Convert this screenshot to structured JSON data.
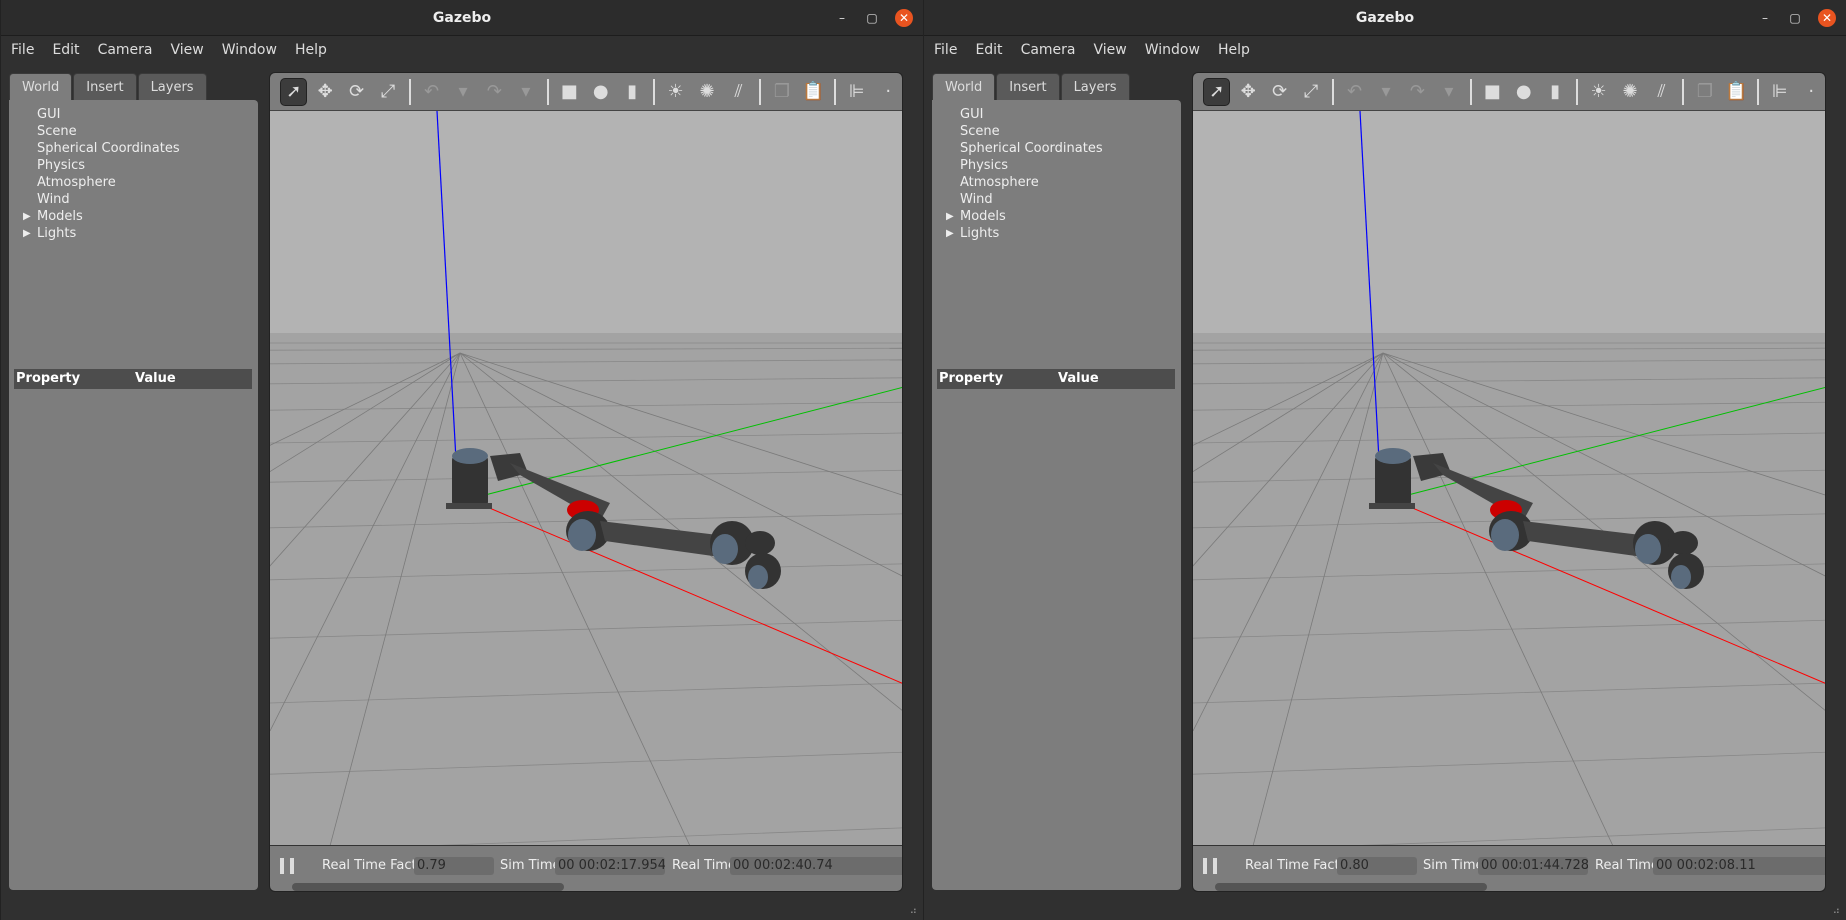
{
  "windows": [
    {
      "title": "Gazebo",
      "menu": [
        "File",
        "Edit",
        "Camera",
        "View",
        "Window",
        "Help"
      ],
      "tabs": [
        "World",
        "Insert",
        "Layers"
      ],
      "tree": [
        "GUI",
        "Scene",
        "Spherical Coordinates",
        "Physics",
        "Atmosphere",
        "Wind",
        "Models",
        "Lights"
      ],
      "property_header": "Property",
      "value_header": "Value",
      "status": {
        "rtf_label": "Real Time Factor:",
        "rtf": "0.79",
        "sim_label": "Sim Time:",
        "sim": "00 00:02:17.954",
        "real_label": "Real Time:",
        "real": "00 00:02:40.74"
      }
    },
    {
      "title": "Gazebo",
      "menu": [
        "File",
        "Edit",
        "Camera",
        "View",
        "Window",
        "Help"
      ],
      "tabs": [
        "World",
        "Insert",
        "Layers"
      ],
      "tree": [
        "GUI",
        "Scene",
        "Spherical Coordinates",
        "Physics",
        "Atmosphere",
        "Wind",
        "Models",
        "Lights"
      ],
      "property_header": "Property",
      "value_header": "Value",
      "status": {
        "rtf_label": "Real Time Factor:",
        "rtf": "0.80",
        "sim_label": "Sim Time:",
        "sim": "00 00:01:44.728",
        "real_label": "Real Time:",
        "real": "00 00:02:08.11"
      }
    }
  ],
  "colors": {
    "close": "#e95420",
    "sky": "#b3b3b3",
    "ground": "#a3a3a3",
    "x_axis": "#ff0000",
    "y_axis": "#00c000",
    "z_axis": "#0000ff"
  }
}
